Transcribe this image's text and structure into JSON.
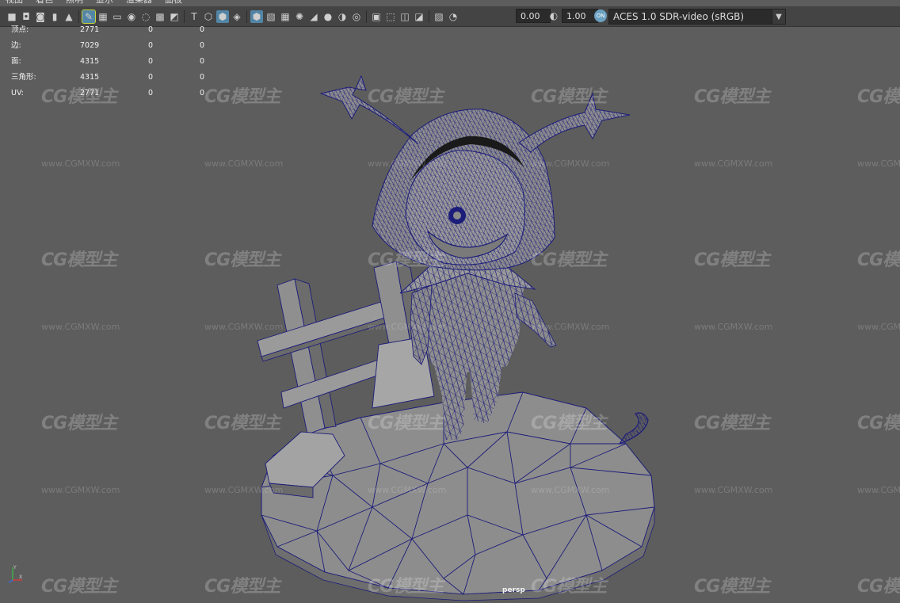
{
  "menu": [
    "视图",
    "着色",
    "照明",
    "显示",
    "渲染器",
    "面板"
  ],
  "toolbar": {
    "exposure_value": "0.00",
    "gamma_value": "1.00",
    "colorspace_icon_text": "ON",
    "colorspace_value": "ACES 1.0 SDR-video (sRGB)",
    "icons": [
      "camera-icon",
      "camera-lock-icon",
      "camera-attr-icon",
      "bookmark-icon",
      "image-plane-icon",
      "grease-pencil-icon",
      "grid-icon",
      "film-gate-icon",
      "resolution-gate-icon",
      "gate-mask-icon",
      "field-chart-icon",
      "safe-action-icon",
      "safe-title-icon",
      "wireframe-icon",
      "smooth-shade-icon",
      "default-material-icon",
      "wireframe-on-shaded-icon",
      "xray-icon",
      "textures-icon",
      "lights-icon",
      "shadows-icon",
      "ambient-occlusion-icon",
      "motion-blur-icon",
      "anti-alias-icon",
      "depth-of-field-icon",
      "isolate-select-icon",
      "xray-joints-icon",
      "xray-active-icon",
      "backface-icon",
      "exposure-icon",
      "gamma-icon"
    ]
  },
  "hud": {
    "rows": [
      {
        "label": "顶点:",
        "values": [
          "2771",
          "0",
          "0"
        ]
      },
      {
        "label": "边:",
        "values": [
          "7029",
          "0",
          "0"
        ]
      },
      {
        "label": "面:",
        "values": [
          "4315",
          "0",
          "0"
        ]
      },
      {
        "label": "三角形:",
        "values": [
          "4315",
          "0",
          "0"
        ]
      },
      {
        "label": "UV:",
        "values": [
          "2771",
          "0",
          "0"
        ]
      }
    ]
  },
  "viewport": {
    "camera": "persp",
    "axis_labels": {
      "y": "Y",
      "x": "X"
    }
  },
  "watermark": {
    "logo": "CG模型主",
    "url": "www.CGMXW.com"
  },
  "colors": {
    "background": "#5d5d5d",
    "toolbar": "#444444",
    "wire": "#1c1c7a",
    "surface": "#8c8c8c"
  }
}
